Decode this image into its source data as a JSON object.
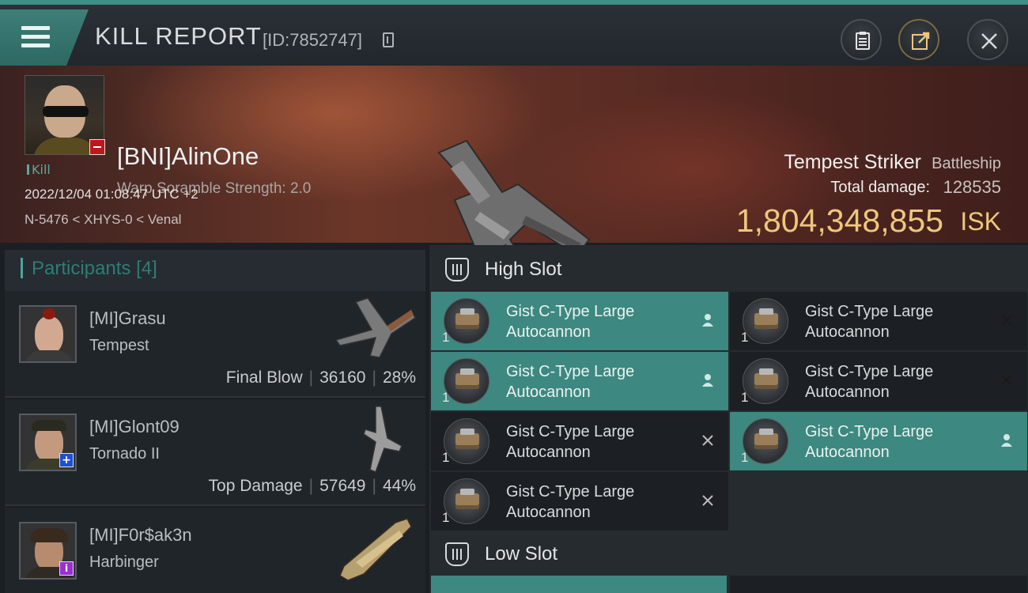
{
  "header": {
    "title": "KILL REPORT",
    "report_id": "[ID:7852747]",
    "buttons": [
      "clipboard",
      "share",
      "close"
    ]
  },
  "victim": {
    "name": "[BNI]AlinOne",
    "scramble": "Warp Soramble Strength: 2.0",
    "tag": "Kill",
    "timestamp": "2022/12/04 01:08:47 UTC +2",
    "location": "N-5476 < XHYS-0 < Venal"
  },
  "ship": {
    "name": "Tempest Striker",
    "class": "Battleship",
    "damage_label": "Total damage:",
    "damage_value": "128535",
    "isk_value": "1,804,348,855",
    "isk_unit": "ISK",
    "type": "Kill"
  },
  "participants": {
    "label": "Participants",
    "count": "[4]",
    "rows": [
      {
        "name": "[MI]Grasu",
        "ship": "Tempest",
        "role": "Final Blow",
        "damage": "36160",
        "percent": "28%"
      },
      {
        "name": "[MI]Glont09",
        "ship": "Tornado II",
        "role": "Top Damage",
        "damage": "57649",
        "percent": "44%"
      },
      {
        "name": "[MI]F0r$ak3n",
        "ship": "Harbinger",
        "role": "",
        "damage": "",
        "percent": ""
      }
    ]
  },
  "slots": {
    "high": {
      "label": "High Slot",
      "modules": [
        {
          "name": "Gist C-Type Large Autocannon",
          "qty": "1",
          "status": "dropped"
        },
        {
          "name": "Gist C-Type Large Autocannon",
          "qty": "1",
          "status": "destroyed"
        },
        {
          "name": "Gist C-Type Large Autocannon",
          "qty": "1",
          "status": "dropped"
        },
        {
          "name": "Gist C-Type Large Autocannon",
          "qty": "1",
          "status": "destroyed"
        },
        {
          "name": "Gist C-Type Large Autocannon",
          "qty": "1",
          "status": "destroyed"
        },
        {
          "name": "Gist C-Type Large Autocannon",
          "qty": "1",
          "status": "dropped"
        },
        {
          "name": "Gist C-Type Large Autocannon",
          "qty": "1",
          "status": "destroyed"
        }
      ]
    },
    "low": {
      "label": "Low Slot"
    }
  },
  "colors": {
    "accent": "#3d8880",
    "isk": "#efc77c",
    "badge_red": "#c0161d",
    "badge_blue": "#1f4fd1",
    "badge_purple": "#9b2fd6"
  }
}
